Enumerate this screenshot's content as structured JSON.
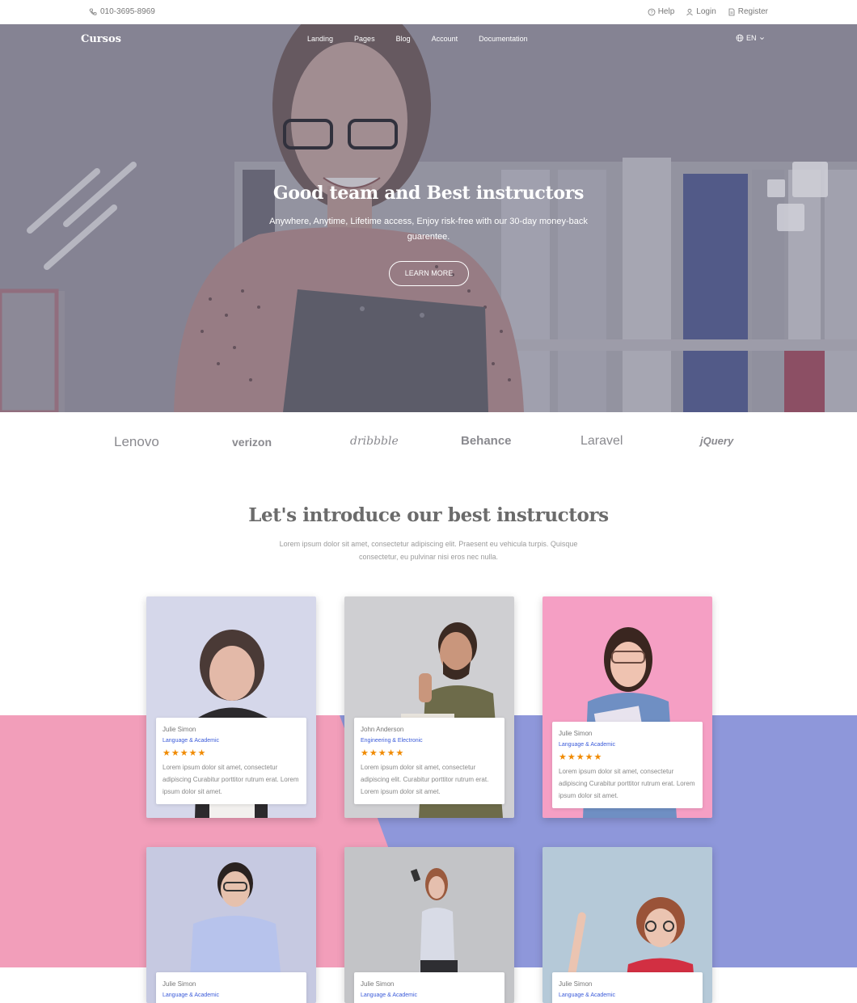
{
  "topbar": {
    "phone": "010-3695-8969",
    "help": "Help",
    "login": "Login",
    "register": "Register"
  },
  "nav": {
    "brand": "Cursos",
    "links": [
      "Landing",
      "Pages",
      "Blog",
      "Account",
      "Documentation"
    ],
    "language": "EN"
  },
  "hero": {
    "title": "Good team and Best instructors",
    "subtitle": "Anywhere, Anytime, Lifetime access, Enjoy risk-free with our 30-day money-back guarentee.",
    "button": "LEARN MORE"
  },
  "logos": [
    "Lenovo",
    "verizon",
    "dribbble",
    "Behance",
    "Laravel",
    "jQuery"
  ],
  "section": {
    "title": "Let's introduce our best instructors",
    "subtitle": "Lorem ipsum dolor sit amet, consectetur adipiscing elit. Praesent eu vehicula turpis. Quisque consectetur, eu pulvinar nisi eros nec nulla."
  },
  "instructors": [
    {
      "name": "Julie Simon",
      "category": "Language & Academic",
      "stars": "★★★★★",
      "description": "Lorem ipsum dolor sit amet, consectetur adipiscing Curabitur porttitor rutrum erat. Lorem ipsum dolor sit amet."
    },
    {
      "name": "John Anderson",
      "category": "Engineering & Electronic",
      "stars": "★★★★★",
      "description": "Lorem ipsum dolor sit amet, consectetur adipiscing elit. Curabitur porttitor rutrum erat. Lorem ipsum dolor sit amet."
    },
    {
      "name": "Julie Simon",
      "category": "Language & Academic",
      "stars": "★★★★★",
      "description": "Lorem ipsum dolor sit amet, consectetur adipiscing Curabitur porttitor rutrum erat. Lorem ipsum dolor sit amet."
    },
    {
      "name": "Julie Simon",
      "category": "Language & Academic"
    },
    {
      "name": "Julie Simon",
      "category": "Language & Academic"
    },
    {
      "name": "Julie Simon",
      "category": "Language & Academic"
    }
  ],
  "colors": {
    "accent_link": "#3b5bd9",
    "star": "#f08a00",
    "band_pink": "#f29eba",
    "band_purple": "#8e97da"
  }
}
